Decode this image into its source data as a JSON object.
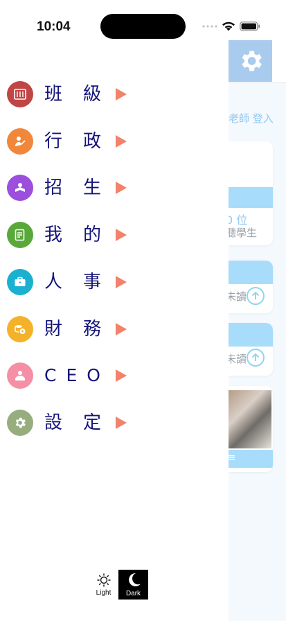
{
  "status": {
    "time": "10:04"
  },
  "menu": [
    {
      "label": "班級",
      "color": "#c04545",
      "icon": "classroom-icon"
    },
    {
      "label": "行政",
      "color": "#f0873a",
      "icon": "teacher-icon"
    },
    {
      "label": "招生",
      "color": "#9b4fdc",
      "icon": "student-reading-icon"
    },
    {
      "label": "我的",
      "color": "#58a83a",
      "icon": "checklist-icon"
    },
    {
      "label": "人事",
      "color": "#1ab0d0",
      "icon": "briefcase-icon"
    },
    {
      "label": "財務",
      "color": "#f4b22b",
      "icon": "coins-icon"
    },
    {
      "label": "CEO",
      "color": "#f58fa6",
      "icon": "ceo-desk-icon"
    },
    {
      "label": "設定",
      "color": "#97ad7e",
      "icon": "gear-icon"
    }
  ],
  "theme": {
    "light_label": "Light",
    "dark_label": "Dark"
  },
  "background": {
    "login_text": "老師 登入",
    "card1_line1": "0 位",
    "card1_line2": "聽學生",
    "card2_text": "未讀",
    "card3_text": "未讀",
    "card4_text": "≡"
  }
}
